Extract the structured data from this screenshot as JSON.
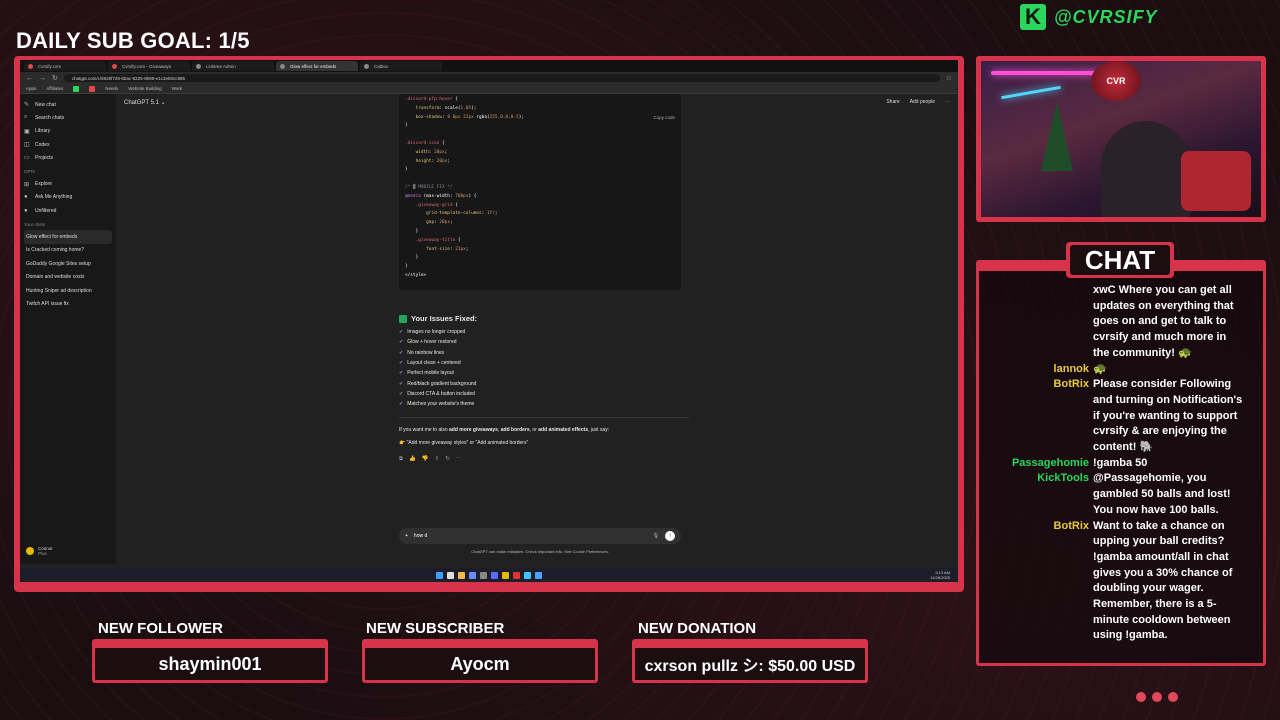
{
  "overlay": {
    "goal": "DAILY SUB GOAL: 1/5",
    "handle": "@CVRSIFY",
    "chat_title": "CHAT",
    "new_follower_label": "NEW FOLLOWER",
    "new_follower_value": "shaymin001",
    "new_subscriber_label": "NEW SUBSCRIBER",
    "new_subscriber_value": "Ayocm",
    "new_donation_label": "NEW DONATION",
    "new_donation_value": "cxrson pullz シ: $50.00 USD",
    "accent_color": "#d7334a",
    "brand_color": "#2bd65a"
  },
  "browser": {
    "tabs": [
      "Cvrsify.com",
      "Cvrsify.com - Giveaways",
      "Linktree Admin",
      "Glow effect for embeds",
      "Catbox"
    ],
    "url": "chatgpt.com/c/6928f729-6bac-8225-9b98-e1c3e50cc885",
    "bookmarks": [
      "Apps",
      "Affiliates",
      "Needs",
      "Website Building",
      "Work"
    ]
  },
  "chatgpt": {
    "model": "ChatGPT 5.1",
    "share": "Share",
    "add_people": "Add people",
    "nav": [
      "New chat",
      "Search chats",
      "Library",
      "Codex",
      "Projects"
    ],
    "gpts_label": "GPTs",
    "gpts": [
      "Explore",
      "Ask Me Anything",
      "Unfiltered"
    ],
    "your_chats_label": "Your chats",
    "chats": [
      "Glow effect for embeds",
      "Is Cracked coming home?",
      "GoDaddy Google Sites setup",
      "Domain and website costs",
      "Hunting Sniper ad description",
      "Twitch API issue fix"
    ],
    "user_name": "Connor",
    "user_plan": "Plus",
    "copy_code": "Copy code",
    "issues_title": "Your Issues Fixed:",
    "issues": [
      "Images no longer cropped",
      "Glow + hover restored",
      "No rainbow lines",
      "Layout clean + centered",
      "Perfect mobile layout",
      "Red/black gradient background",
      "Discord CTA & button included",
      "Matches your website's theme"
    ],
    "followup_pre": "If you want me to also ",
    "followup_b1": "add more giveaways",
    "followup_sep1": ", ",
    "followup_b2": "add borders",
    "followup_sep2": ", or ",
    "followup_b3": "add animated effects",
    "followup_post": ", just say:",
    "hint": "👉 \"Add more giveaway styles\" or \"Add animated borders\"",
    "composer_value": "how d",
    "disclaimer": "ChatGPT can make mistakes. Check important info. See Cookie Preferences."
  },
  "taskbar": {
    "time": "9:13 AM",
    "date": "11/26/2025"
  },
  "chat": [
    {
      "who": "",
      "text": "xwC Where you can get all updates on everything that goes on and get to talk to cvrsify and much more in the community! 🐢",
      "color": "#e8c840"
    },
    {
      "who": "lannok",
      "text": "🐢",
      "color": "#e8c840"
    },
    {
      "who": "BotRix",
      "text": "Please consider Following and turning on Notification's if you're wanting to support cvrsify & are enjoying the content! 🐘",
      "color": "#e8c840"
    },
    {
      "who": "Passagehomie",
      "text": "!gamba 50",
      "color": "#2bd65a"
    },
    {
      "who": "KickTools",
      "text": "@Passagehomie, you gambled 50 balls and lost! You now have 100 balls.",
      "color": "#2bd65a"
    },
    {
      "who": "BotRix",
      "text": "Want to take a chance on upping your ball credits? !gamba amount/all in chat gives you a 30% chance of doubling your wager. Remember, there is a 5-minute cooldown between using !gamba.",
      "color": "#e8c840"
    }
  ]
}
